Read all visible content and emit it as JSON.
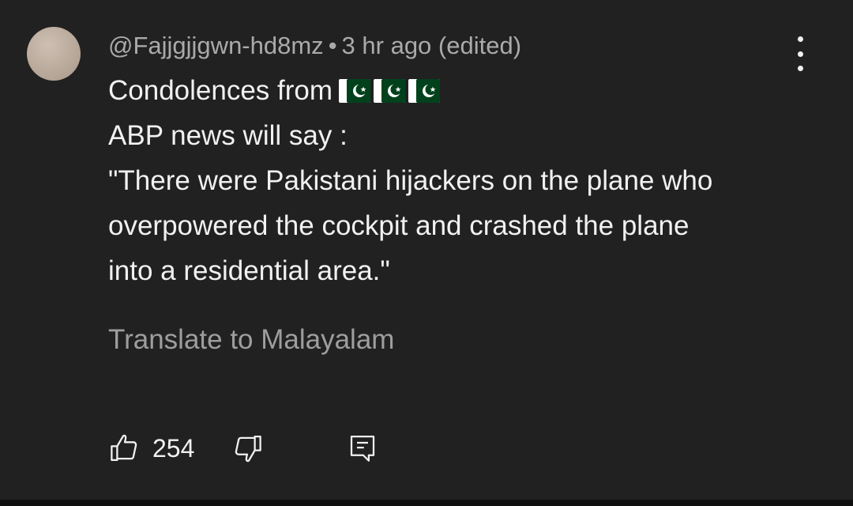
{
  "comment": {
    "author": "@Fajjgjjgwn-hd8mz",
    "separator": "•",
    "time": "3 hr ago (edited)",
    "lines": [
      "Condolences from",
      "ABP news will say :",
      "\"There were Pakistani hijackers on the plane who",
      "overpowered the cockpit and crashed the plane",
      "into a residential area.\""
    ],
    "flags": [
      "pakistan-flag-emoji",
      "pakistan-flag-emoji",
      "pakistan-flag-emoji"
    ],
    "translate_label": "Translate to Malayalam",
    "like_count": "254"
  },
  "icons": {
    "more": "more-vert-icon",
    "like": "thumb-up-icon",
    "dislike": "thumb-down-icon",
    "reply": "comment-icon"
  },
  "colors": {
    "background": "#212121",
    "text_primary": "#f1f1f1",
    "text_secondary": "#aaaaaa",
    "flag_green": "#01411c"
  }
}
